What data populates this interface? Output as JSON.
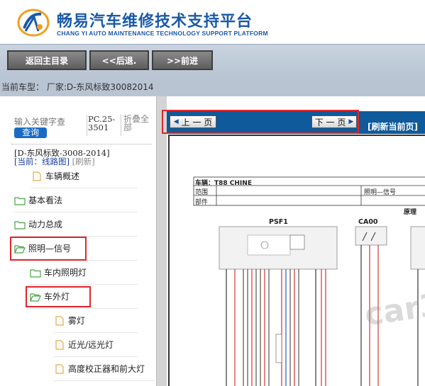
{
  "header": {
    "title": "畅易汽车维修技术支持平台",
    "subtitle": "CHANG YI AUTO MAINTENANCE TECHNOLOGY SUPPORT PLATFORM",
    "brand_color": "#1a5aa8"
  },
  "nav": {
    "home": "返回主目录",
    "back": "<<后退.",
    "forward": ">>前进"
  },
  "info": {
    "current_model": "当前车型：  厂家:D-东风标致30082014"
  },
  "sidebar": {
    "search_placeholder": "输入关键字查",
    "search_button": "查询",
    "pc_code": "PC.25-3501",
    "collapse_all": "折叠全部",
    "model": "[D-东风标致-3008-2014]",
    "current_prefix": "[当前：线路图]",
    "refresh": "[刷新]",
    "tree": [
      {
        "label": "车辆概述",
        "type": "file"
      },
      {
        "label": "基本看法",
        "type": "folder"
      },
      {
        "label": "动力总成",
        "type": "folder"
      },
      {
        "label": "照明—信号",
        "type": "folder-open"
      },
      {
        "label": "车内照明灯",
        "type": "folder"
      },
      {
        "label": "车外灯",
        "type": "folder-open"
      },
      {
        "label": "雾灯",
        "type": "file"
      },
      {
        "label": "近光/远光灯",
        "type": "file"
      },
      {
        "label": "高度校正器和前大灯",
        "type": "file"
      }
    ]
  },
  "pager": {
    "prev": "上 一 页",
    "next": "下 一 页",
    "refresh_page": "[刷新当前页]",
    "bar_color": "#0f5a9a"
  },
  "diagram": {
    "vehicle": "车辆：T88 CHINE",
    "range_label": "范围",
    "range_value": "照明—信号",
    "part_label": "部件",
    "principle": "原理",
    "psf": "PSF1",
    "ca": "CA00",
    "watermark": "car3"
  }
}
